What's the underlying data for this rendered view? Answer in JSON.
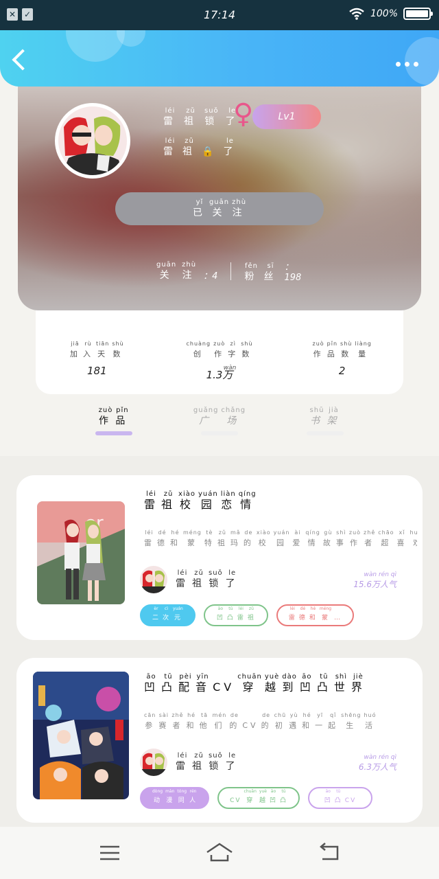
{
  "status": {
    "time": "17:14",
    "battery": "100%"
  },
  "profile": {
    "name": {
      "pinyin": [
        "léi",
        "zǔ",
        "suǒ",
        "le"
      ],
      "chars": [
        "雷",
        "祖",
        "锁",
        "了"
      ]
    },
    "level": "Lv1",
    "subtitle": {
      "pinyin": [
        "léi",
        "zǔ",
        "",
        "le"
      ],
      "chars": [
        "雷",
        "祖",
        "🔒",
        "了"
      ]
    },
    "follow_btn": {
      "pinyin": [
        "yǐ",
        "guān",
        "zhù"
      ],
      "chars": [
        "已",
        "关",
        "注"
      ]
    },
    "following": {
      "pinyin": [
        "guān",
        "zhù"
      ],
      "chars": [
        "关",
        "注"
      ],
      "value": "：4"
    },
    "fans": {
      "pinyin": [
        "fěn",
        "sī"
      ],
      "chars": [
        "粉",
        "丝"
      ],
      "value": "：198"
    }
  },
  "summary": [
    {
      "pinyin": [
        "jiā",
        "rù",
        "tiān",
        "shù"
      ],
      "chars": [
        "加",
        "入",
        "天",
        "数"
      ],
      "value": "181"
    },
    {
      "pinyin": [
        "chuàng",
        "zuò",
        "zì",
        "shù"
      ],
      "chars": [
        "创",
        "作",
        "字",
        "数"
      ],
      "value": "1.3万",
      "value_py": "wàn"
    },
    {
      "pinyin": [
        "zuò",
        "pǐn",
        "shù",
        "liàng"
      ],
      "chars": [
        "作",
        "品",
        "数",
        "量"
      ],
      "value": "2"
    }
  ],
  "tabs": [
    {
      "pinyin": [
        "zuò",
        "pǐn"
      ],
      "chars": [
        "作",
        "品"
      ],
      "active": true
    },
    {
      "pinyin": [
        "guǎng",
        "chǎng"
      ],
      "chars": [
        "广",
        "场"
      ],
      "active": false
    },
    {
      "pinyin": [
        "shū",
        "jià"
      ],
      "chars": [
        "书",
        "架"
      ],
      "active": false
    }
  ],
  "works": [
    {
      "title": {
        "pinyin": [
          "léi",
          "zǔ",
          "xiào",
          "yuán",
          "liàn",
          "qíng"
        ],
        "chars": [
          "雷",
          "祖",
          "校",
          "园",
          "恋",
          "情"
        ]
      },
      "desc": {
        "pinyin": [
          "léi",
          "dé",
          "hé",
          "méng",
          "tè",
          "zǔ",
          "mǎ",
          "de",
          "xiào",
          "yuán",
          "ài",
          "qíng",
          "gù",
          "shì",
          "zuò",
          "zhě",
          "chāo",
          "xǐ",
          "huān",
          "léi",
          "zǔ"
        ],
        "chars": [
          "雷",
          "德",
          "和",
          "蒙",
          "特",
          "祖",
          "玛",
          "的",
          "校",
          "园",
          "爱",
          "情",
          "故",
          "事",
          "作",
          "者",
          "超",
          "喜",
          "欢",
          "雷",
          "祖"
        ]
      },
      "author": {
        "pinyin": [
          "léi",
          "zǔ",
          "suǒ",
          "le"
        ],
        "chars": [
          "雷",
          "祖",
          "锁",
          "了"
        ]
      },
      "popularity": {
        "value": "15.6万人气",
        "pinyin": "wàn rén qì"
      },
      "tags": [
        {
          "pinyin": [
            "èr",
            "cì",
            "yuán"
          ],
          "chars": [
            "二",
            "次",
            "元"
          ],
          "color": "#4fc9ef",
          "filled": true
        },
        {
          "pinyin": [
            "āo",
            "tū",
            "léi",
            "zǔ"
          ],
          "chars": [
            "凹",
            "凸",
            "雷",
            "祖"
          ],
          "color": "#7fc48a",
          "filled": false
        },
        {
          "pinyin": [
            "léi",
            "dé",
            "hé",
            "méng"
          ],
          "chars": [
            "雷",
            "德",
            "和",
            "蒙",
            "…"
          ],
          "color": "#ea7a7a",
          "filled": false
        }
      ]
    },
    {
      "title": {
        "pinyin": [
          "āo",
          "tū",
          "pèi",
          "yīn",
          "",
          "chuān",
          "yuè",
          "dào",
          "āo",
          "tū",
          "shì",
          "jiè"
        ],
        "chars": [
          "凹",
          "凸",
          "配",
          "音",
          "CV",
          "穿",
          "越",
          "到",
          "凹",
          "凸",
          "世",
          "界"
        ]
      },
      "desc": {
        "pinyin": [
          "cān",
          "sài",
          "zhě",
          "hé",
          "tā",
          "mén",
          "de",
          "",
          "de",
          "chū",
          "yù",
          "hé",
          "yī",
          "qǐ",
          "shēng",
          "huó"
        ],
        "chars": [
          "参",
          "赛",
          "者",
          "和",
          "他",
          "们",
          "的",
          "CV",
          "的",
          "初",
          "遇",
          "和",
          "一",
          "起",
          "生",
          "活"
        ]
      },
      "author": {
        "pinyin": [
          "léi",
          "zǔ",
          "suǒ",
          "le"
        ],
        "chars": [
          "雷",
          "祖",
          "锁",
          "了"
        ]
      },
      "popularity": {
        "value": "6.3万人气",
        "pinyin": "wàn rén qì"
      },
      "tags": [
        {
          "pinyin": [
            "dòng",
            "màn",
            "tóng",
            "rén"
          ],
          "chars": [
            "动",
            "漫",
            "同",
            "人"
          ],
          "color": "#c9a3ec",
          "filled": true
        },
        {
          "pinyin": [
            "",
            "chuān",
            "yuè",
            "āo",
            "tū"
          ],
          "chars": [
            "CV",
            "穿",
            "越",
            "凹",
            "凸"
          ],
          "color": "#7fc48a",
          "filled": false
        },
        {
          "pinyin": [
            "āo",
            "tū",
            ""
          ],
          "chars": [
            "凹",
            "凸",
            "CV"
          ],
          "color": "#c9a3ec",
          "filled": false
        }
      ]
    }
  ]
}
